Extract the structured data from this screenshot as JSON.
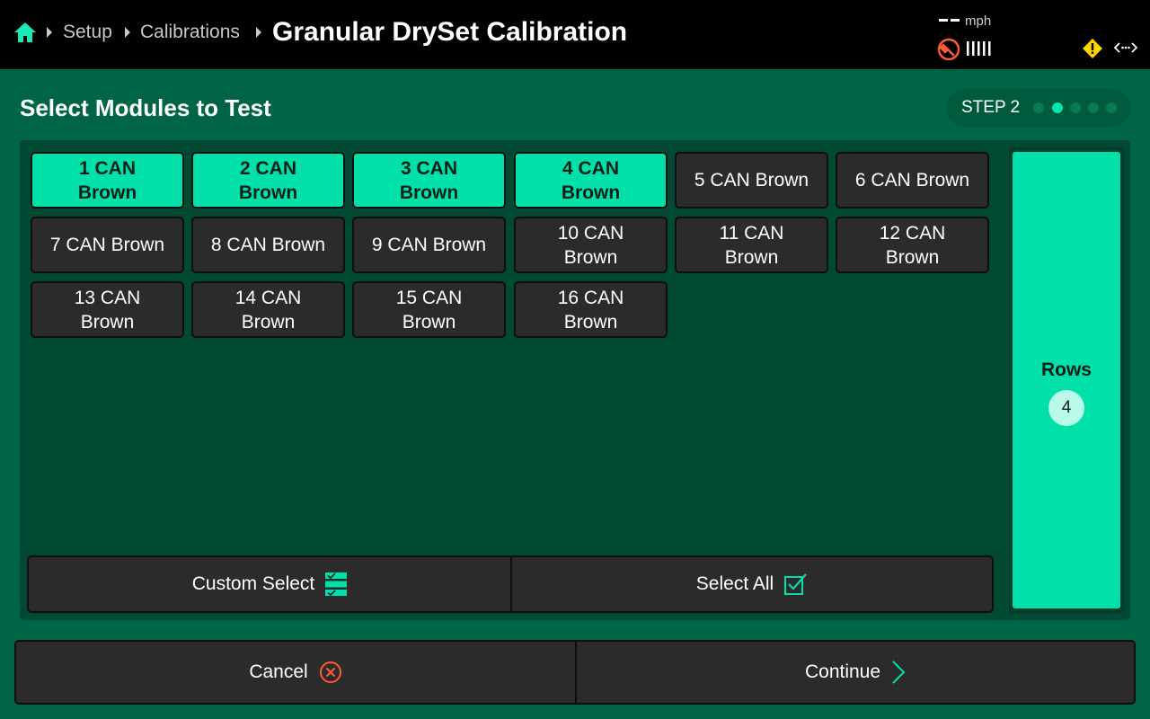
{
  "header": {
    "breadcrumbs": [
      "Setup",
      "Calibrations"
    ],
    "title": "Granular DrySet Calibration",
    "speed_value": "--",
    "speed_unit": "mph",
    "icons": {
      "home": "home-icon",
      "gps": "gps-satellite-icon",
      "signal": "signal-bars-icon",
      "warning": "warning-icon",
      "connection": "connection-arrows-icon"
    },
    "colors": {
      "home": "#1de9b6",
      "gps": "#ff5a3c",
      "warning": "#ffd600"
    }
  },
  "page": {
    "title": "Select Modules to Test",
    "step": {
      "label": "STEP 2",
      "total": 5,
      "current": 2
    }
  },
  "modules": [
    {
      "label": "1 CAN Brown",
      "selected": true
    },
    {
      "label": "2 CAN Brown",
      "selected": true
    },
    {
      "label": "3 CAN Brown",
      "selected": true
    },
    {
      "label": "4 CAN Brown",
      "selected": true
    },
    {
      "label": "5 CAN Brown",
      "selected": false
    },
    {
      "label": "6 CAN Brown",
      "selected": false
    },
    {
      "label": "7 CAN Brown",
      "selected": false
    },
    {
      "label": "8 CAN Brown",
      "selected": false
    },
    {
      "label": "9 CAN Brown",
      "selected": false
    },
    {
      "label": "10 CAN Brown",
      "selected": false
    },
    {
      "label": "11 CAN Brown",
      "selected": false
    },
    {
      "label": "12 CAN Brown",
      "selected": false
    },
    {
      "label": "13 CAN Brown",
      "selected": false
    },
    {
      "label": "14 CAN Brown",
      "selected": false
    },
    {
      "label": "15 CAN Brown",
      "selected": false
    },
    {
      "label": "16 CAN Brown",
      "selected": false
    }
  ],
  "rows": {
    "label": "Rows",
    "count": "4"
  },
  "actions": {
    "custom_select": "Custom Select",
    "select_all": "Select All"
  },
  "footer": {
    "cancel": "Cancel",
    "continue": "Continue"
  },
  "colors": {
    "background": "#006446",
    "accent": "#00e0a8",
    "button": "#2b2b2b",
    "cancel_icon": "#ff5a3c"
  }
}
